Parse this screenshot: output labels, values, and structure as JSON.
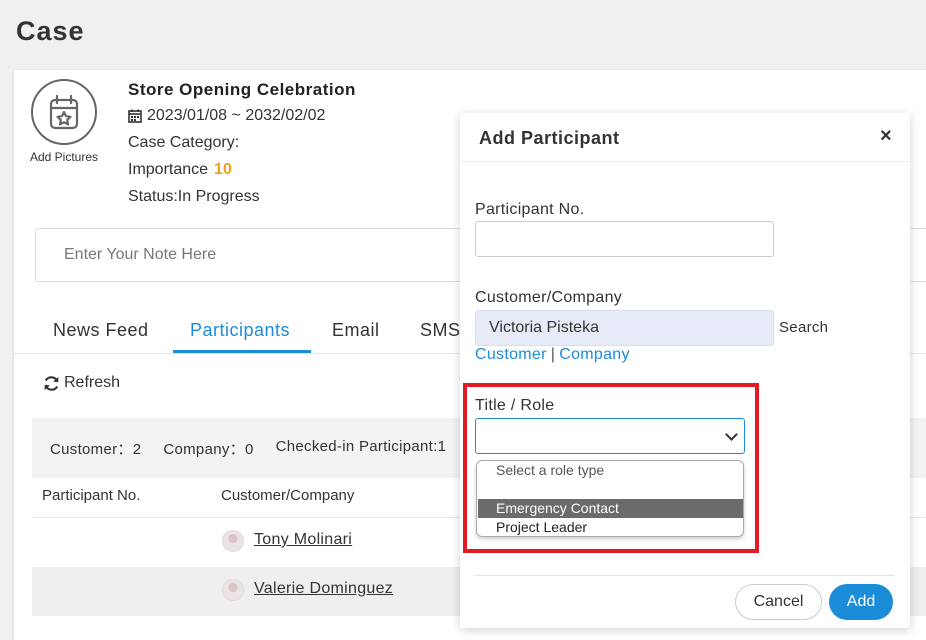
{
  "page": {
    "title": "Case"
  },
  "case": {
    "add_pictures_label": "Add Pictures",
    "name": "Store Opening Celebration",
    "date_range": "2023/01/08 ~ 2032/02/02",
    "category_label": "Case Category:",
    "importance_label": "Importance",
    "importance_value": "10",
    "status_label": "Status:In Progress"
  },
  "note": {
    "placeholder": "Enter Your Note Here"
  },
  "tabs": [
    {
      "label": "News Feed",
      "active": false
    },
    {
      "label": "Participants",
      "active": true
    },
    {
      "label": "Email",
      "active": false
    },
    {
      "label": "SMS",
      "active": false
    }
  ],
  "toolbar": {
    "refresh_label": "Refresh"
  },
  "stats": {
    "customer": "Customer：2",
    "company": "Company：0",
    "checked_in": "Checked-in Participant:1"
  },
  "table": {
    "columns": [
      "Participant No.",
      "Customer/Company"
    ],
    "rows": [
      {
        "participant_no": "",
        "customer": "Tony Molinari"
      },
      {
        "participant_no": "",
        "customer": "Valerie Dominguez"
      }
    ]
  },
  "modal": {
    "title": "Add Participant",
    "close_label": "×",
    "participant_no_label": "Participant No.",
    "participant_no_value": "",
    "customer_company_label": "Customer/Company",
    "customer_company_value": "Victoria Pisteka",
    "search_label": "Search",
    "customer_link": "Customer",
    "link_separator": "|",
    "company_link": "Company",
    "title_role_label": "Title / Role",
    "title_role_value": "",
    "role_options": {
      "placeholder": "Select a role type",
      "items": [
        "Emergency Contact",
        "Project Leader"
      ],
      "highlighted": "Emergency Contact"
    },
    "cancel_label": "Cancel",
    "add_label": "Add"
  },
  "colors": {
    "accent": "#1a8cd8",
    "importance": "#f0a020",
    "highlight_box": "#e01b24"
  }
}
